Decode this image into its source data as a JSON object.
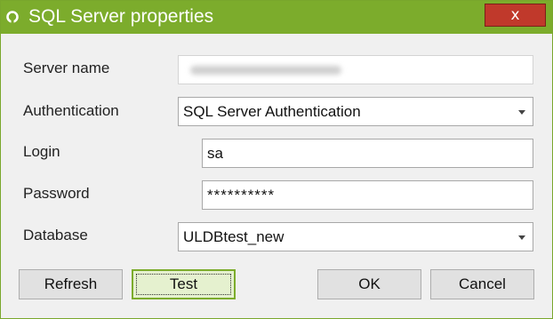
{
  "window": {
    "title": "SQL Server properties",
    "close_label": "x"
  },
  "form": {
    "server_name": {
      "label": "Server name",
      "value": ""
    },
    "authentication": {
      "label": "Authentication",
      "value": "SQL Server Authentication"
    },
    "login": {
      "label": "Login",
      "value": "sa"
    },
    "password": {
      "label": "Password",
      "value": "**********"
    },
    "database": {
      "label": "Database",
      "value": "ULDBtest_new"
    }
  },
  "buttons": {
    "refresh": "Refresh",
    "test": "Test",
    "ok": "OK",
    "cancel": "Cancel"
  },
  "colors": {
    "titlebar": "#7cac2c",
    "close_button": "#c0392b",
    "focus_border": "#7cac2c"
  }
}
